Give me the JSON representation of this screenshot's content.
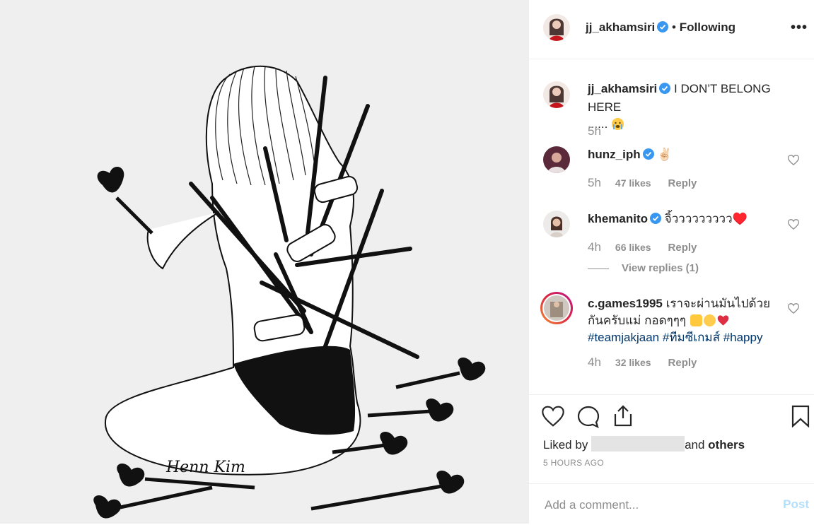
{
  "post": {
    "author": "jj_akhamsiri",
    "follow_status": "Following",
    "more_label": "•••",
    "artwork_signature": "Henn Kim"
  },
  "caption": {
    "username": "jj_akhamsiri",
    "text": "I DON’T BELONG HERE",
    "text2": "......",
    "age": "5h"
  },
  "comments": [
    {
      "username": "hunz_iph",
      "text": "✌🏻",
      "age": "5h",
      "likes": "47 likes",
      "reply": "Reply"
    },
    {
      "username": "khemanito",
      "text": "จิ้ววววววววว♥️",
      "age": "4h",
      "likes": "66 likes",
      "reply": "Reply",
      "view_replies": "View replies (1)"
    },
    {
      "username": "c.games1995",
      "text_line1": "เราจะผ่านมันไปด้วย",
      "text_line2": "กันครับแม่ กอดๆๆๆ",
      "tag1": "#teamjakjaan",
      "tag2": "#ทีมซีเกมส์",
      "tag3": "#happy",
      "age": "4h",
      "likes": "32 likes",
      "reply": "Reply"
    }
  ],
  "likes_summary": {
    "prefix": "Liked by",
    "joiner": "and",
    "others": "others"
  },
  "timestamp": "5 HOURS AGO",
  "comment_box": {
    "placeholder": "Add a comment...",
    "post_label": "Post"
  },
  "colors": {
    "verified": "#3897f0",
    "link": "#003569",
    "muted": "#8e8e8e",
    "post_disabled": "#b2dffc"
  }
}
